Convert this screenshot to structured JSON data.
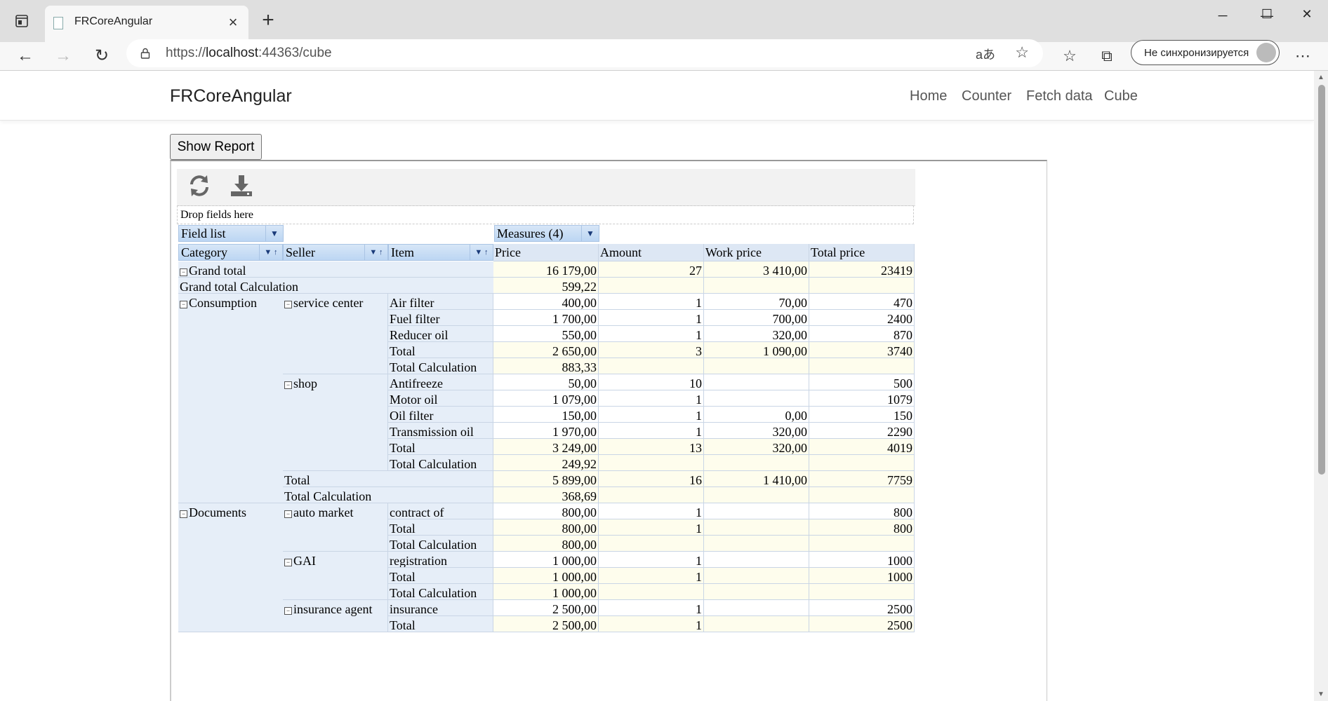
{
  "browser": {
    "tab_title": "FRCoreAngular",
    "url_scheme": "https://",
    "url_host": "localhost",
    "url_rest": ":44363/cube",
    "sync_label": "Не синхронизируется"
  },
  "app": {
    "brand": "FRCoreAngular",
    "nav": [
      "Home",
      "Counter",
      "Fetch data",
      "Cube"
    ],
    "show_report": "Show Report"
  },
  "pivot": {
    "drop_zone": "Drop fields here",
    "field_list": "Field list",
    "measures": "Measures (4)",
    "row_fields": [
      "Category",
      "Seller",
      "Item"
    ],
    "measure_headers": [
      "Price",
      "Amount",
      "Work price",
      "Total price"
    ],
    "rows": [
      {
        "c1": "Grand total",
        "v": [
          "16 179,00",
          "27",
          "3 410,00",
          "23419"
        ],
        "total": true
      },
      {
        "c1": "Grand total Calculation",
        "v": [
          "599,22",
          "",
          "",
          ""
        ],
        "total": true
      },
      {
        "c1": "Consumption",
        "c2": "service center",
        "c3": "Air filter",
        "v": [
          "400,00",
          "1",
          "70,00",
          "470"
        ]
      },
      {
        "c3": "Fuel filter",
        "v": [
          "1 700,00",
          "1",
          "700,00",
          "2400"
        ]
      },
      {
        "c3": "Reducer oil",
        "v": [
          "550,00",
          "1",
          "320,00",
          "870"
        ]
      },
      {
        "c3": "Total",
        "v": [
          "2 650,00",
          "3",
          "1 090,00",
          "3740"
        ],
        "total": true
      },
      {
        "c3": "Total Calculation",
        "v": [
          "883,33",
          "",
          "",
          ""
        ],
        "total": true
      },
      {
        "c2": "shop",
        "c3": "Antifreeze",
        "v": [
          "50,00",
          "10",
          "",
          "500"
        ]
      },
      {
        "c3": "Motor oil",
        "v": [
          "1 079,00",
          "1",
          "",
          "1079"
        ]
      },
      {
        "c3": "Oil filter",
        "v": [
          "150,00",
          "1",
          "0,00",
          "150"
        ]
      },
      {
        "c3": "Transmission oil",
        "v": [
          "1 970,00",
          "1",
          "320,00",
          "2290"
        ]
      },
      {
        "c3": "Total",
        "v": [
          "3 249,00",
          "13",
          "320,00",
          "4019"
        ],
        "total": true
      },
      {
        "c3": "Total Calculation",
        "v": [
          "249,92",
          "",
          "",
          ""
        ],
        "total": true
      },
      {
        "c2": "Total",
        "v": [
          "5 899,00",
          "16",
          "1 410,00",
          "7759"
        ],
        "total": true
      },
      {
        "c2": "Total Calculation",
        "v": [
          "368,69",
          "",
          "",
          ""
        ],
        "total": true
      },
      {
        "c1": "Documents",
        "c2": "auto market",
        "c3": "contract of",
        "v": [
          "800,00",
          "1",
          "",
          "800"
        ]
      },
      {
        "c3": "Total",
        "v": [
          "800,00",
          "1",
          "",
          "800"
        ],
        "total": true
      },
      {
        "c3": "Total Calculation",
        "v": [
          "800,00",
          "",
          "",
          ""
        ],
        "total": true
      },
      {
        "c2": "GAI",
        "c3": "registration",
        "v": [
          "1 000,00",
          "1",
          "",
          "1000"
        ]
      },
      {
        "c3": "Total",
        "v": [
          "1 000,00",
          "1",
          "",
          "1000"
        ],
        "total": true
      },
      {
        "c3": "Total Calculation",
        "v": [
          "1 000,00",
          "",
          "",
          ""
        ],
        "total": true
      },
      {
        "c2": "insurance agent",
        "c3": "insurance",
        "v": [
          "2 500,00",
          "1",
          "",
          "2500"
        ]
      },
      {
        "c3": "Total",
        "v": [
          "2 500,00",
          "1",
          "",
          "2500"
        ],
        "total": true
      }
    ]
  }
}
